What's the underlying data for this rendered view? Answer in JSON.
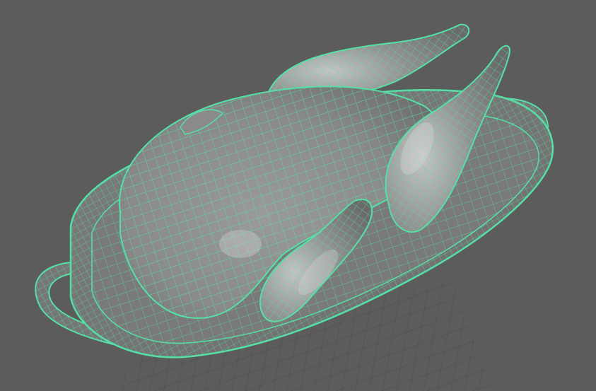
{
  "viewport": {
    "background": "#5c5c5c",
    "grid_color": "#4a4a4a",
    "wire_color": "#55e0a6",
    "shade_color": "#8d8d8d",
    "highlight_color": "#d8d8d8",
    "selected": true
  },
  "scene": {
    "objects": [
      {
        "name": "roast-chicken-body",
        "icon": "mesh"
      },
      {
        "name": "drumstick-left",
        "icon": "mesh"
      },
      {
        "name": "drumstick-right",
        "icon": "mesh"
      },
      {
        "name": "wing-front",
        "icon": "mesh"
      },
      {
        "name": "serving-tray",
        "icon": "mesh"
      }
    ]
  }
}
